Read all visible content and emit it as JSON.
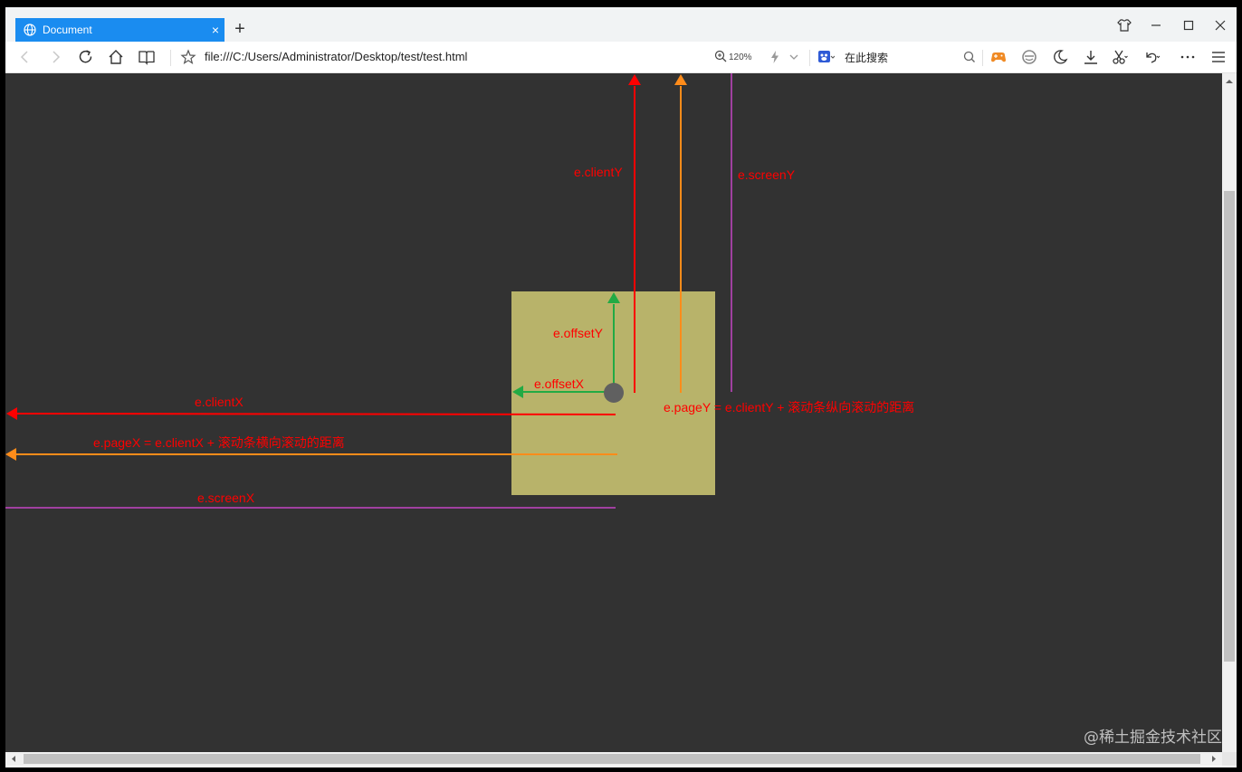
{
  "tab": {
    "title": "Document",
    "close": "×",
    "new_tab": "+"
  },
  "navbar": {
    "address": "file:///C:/Users/Administrator/Desktop/test/test.html",
    "zoom": "120%",
    "search_label": "在此搜索"
  },
  "diagram": {
    "labels": {
      "client_y": "e.clientY",
      "screen_y": "e.screenY",
      "offset_y": "e.offsetY",
      "offset_x": "e.offsetX",
      "client_x": "e.clientX",
      "page_y": "e.pageY = e.clientY + 滚动条纵向滚动的距离",
      "page_x": "e.pageX = e.clientX + 滚动条横向滚动的距离",
      "screen_x": "e.screenX"
    },
    "colors": {
      "background": "#323232",
      "box": "#b8b36a",
      "red": "#ff0000",
      "orange": "#ff8c1a",
      "green": "#22aa44",
      "purple": "#a040a0",
      "dot": "#606060"
    }
  },
  "watermark": "@稀土掘金技术社区"
}
